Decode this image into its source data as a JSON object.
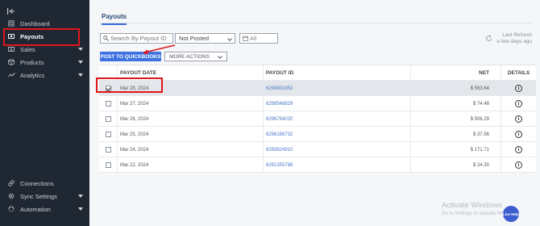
{
  "sidebar": {
    "items": [
      {
        "label": "Dashboard",
        "icon": "grid-icon"
      },
      {
        "label": "Payouts",
        "icon": "payout-icon"
      },
      {
        "label": "Sales",
        "icon": "dollar-icon"
      },
      {
        "label": "Products",
        "icon": "box-icon"
      },
      {
        "label": "Analytics",
        "icon": "chart-line-icon"
      },
      {
        "label": "Connections",
        "icon": "link-icon"
      },
      {
        "label": "Sync Settings",
        "icon": "gear-icon"
      },
      {
        "label": "Automation",
        "icon": "automation-icon"
      }
    ],
    "active": "Payouts"
  },
  "main": {
    "tab_label": "Payouts",
    "search_placeholder": "Search By Payout ID",
    "status_filter": "Not Posted",
    "date_filter": "All",
    "refresh_label": "Last Refresh",
    "refresh_time": "a few days ago",
    "post_button": "POST TO QUICKBOOKS",
    "more_actions": "MORE ACTIONS"
  },
  "table": {
    "headers": {
      "date": "PAYOUT DATE",
      "id": "PAYOUT ID",
      "net": "NET",
      "details": "DETAILS"
    },
    "rows": [
      {
        "date": "Mar 28, 2024",
        "id": "6298801852",
        "net": "$ 563.64",
        "checked": true
      },
      {
        "date": "Mar 27, 2024",
        "id": "6298548829",
        "net": "$ 74.48",
        "checked": false
      },
      {
        "date": "Mar 26, 2024",
        "id": "6296794020",
        "net": "$ 506.29",
        "checked": false
      },
      {
        "date": "Mar 25, 2024",
        "id": "6296186732",
        "net": "$ 37.56",
        "checked": false
      },
      {
        "date": "Mar 24, 2024",
        "id": "6293824910",
        "net": "$ 171.71",
        "checked": false
      },
      {
        "date": "Mar 22, 2024",
        "id": "6291355788",
        "net": "$ 24.30",
        "checked": false
      }
    ]
  },
  "watermark": {
    "line1": "Activate Windows",
    "line2": "Go to Settings to activate Windows."
  },
  "live_help": "Live Help",
  "colors": {
    "sidebar_bg": "#1f2733",
    "accent": "#3d72e0",
    "highlight": "#e0161a"
  }
}
